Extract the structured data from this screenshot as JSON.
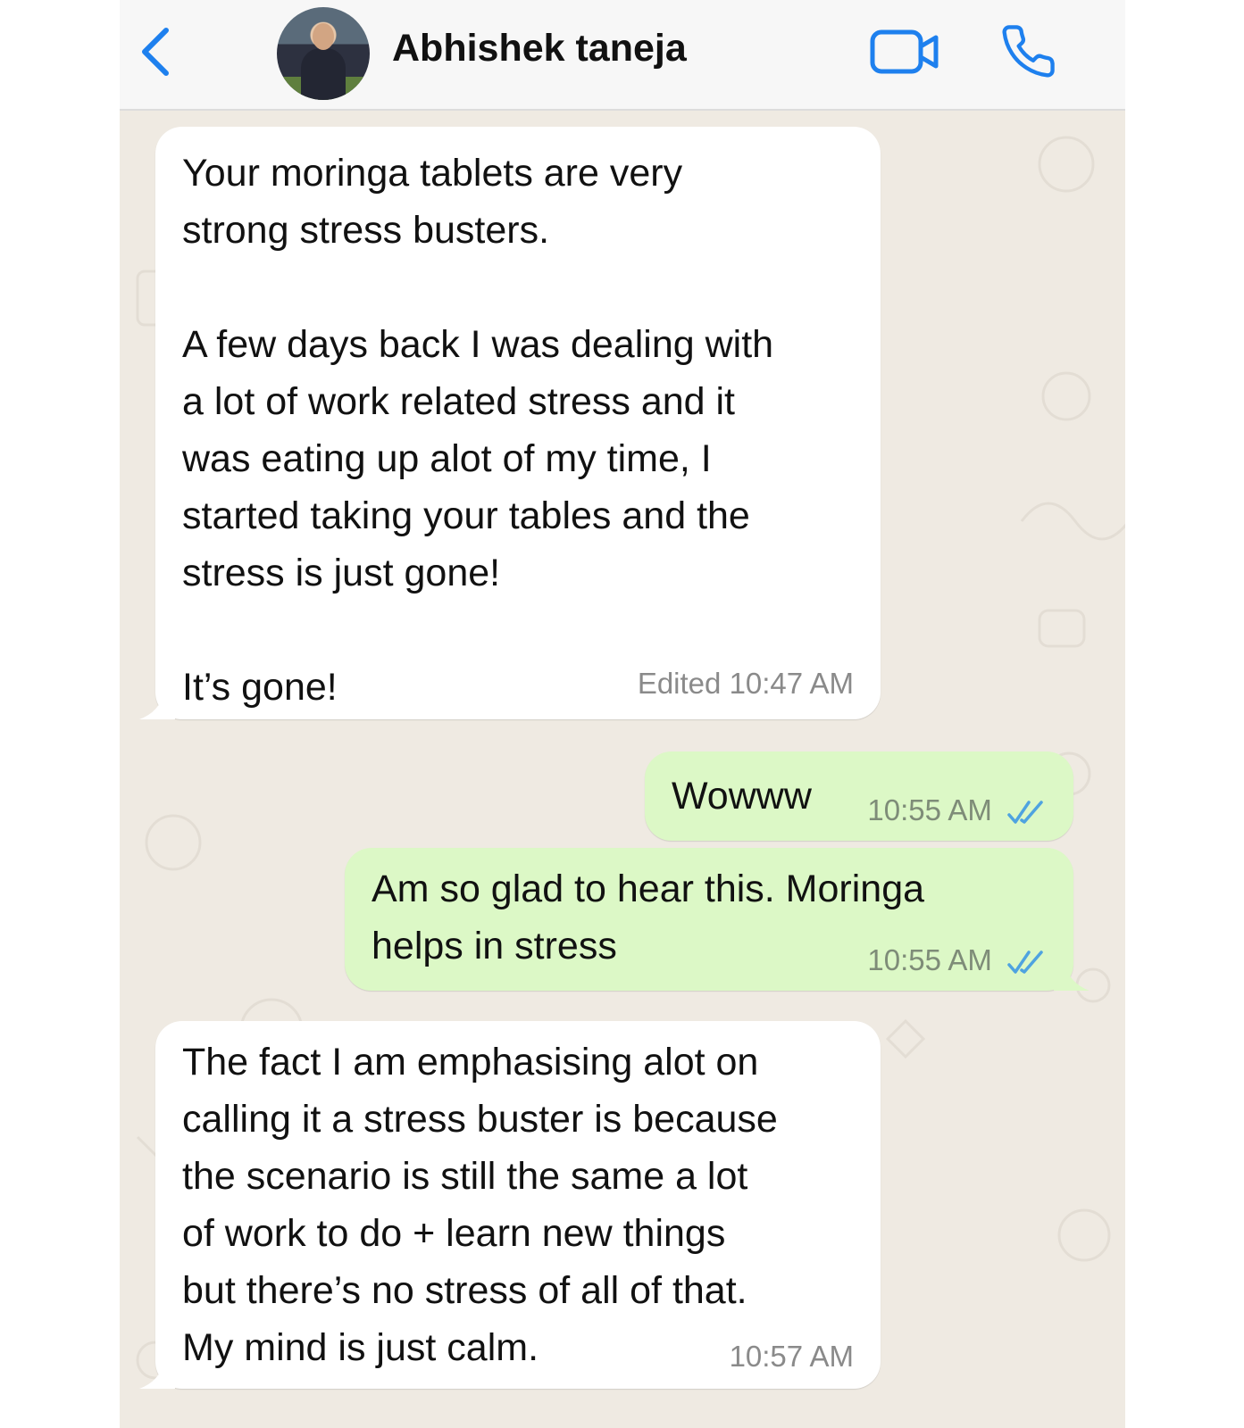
{
  "header": {
    "back_icon": "chevron-left-icon",
    "contact_name": "Abhishek taneja",
    "video_call_icon": "video-camera-icon",
    "voice_call_icon": "phone-icon",
    "accent_color": "#1e80ee"
  },
  "messages": [
    {
      "direction": "incoming",
      "text": "Your moringa tablets are very\nstrong stress busters.\n\nA few days back I was dealing with\na lot of work related stress and it\nwas eating up alot of my time, I\nstarted taking your tables and the\nstress is just gone!\n\nIt’s gone!",
      "edited_label": "Edited",
      "time": "10:47 AM"
    },
    {
      "direction": "outgoing",
      "text": "Wowww",
      "time": "10:55 AM",
      "status": "read"
    },
    {
      "direction": "outgoing",
      "text": "Am so glad to hear this. Moringa\nhelps in stress",
      "time": "10:55 AM",
      "status": "read"
    },
    {
      "direction": "incoming",
      "text": "The fact I am emphasising alot on\ncalling it a stress buster is because\nthe scenario is still the same a lot\nof work to do + learn new things\nbut there’s no stress of all of that.\nMy mind is just calm.",
      "time": "10:57 AM"
    }
  ],
  "colors": {
    "incoming_bubble": "#ffffff",
    "outgoing_bubble": "#dcf8c6",
    "chat_background": "#efeae2",
    "read_ticks": "#4fa3e0"
  }
}
